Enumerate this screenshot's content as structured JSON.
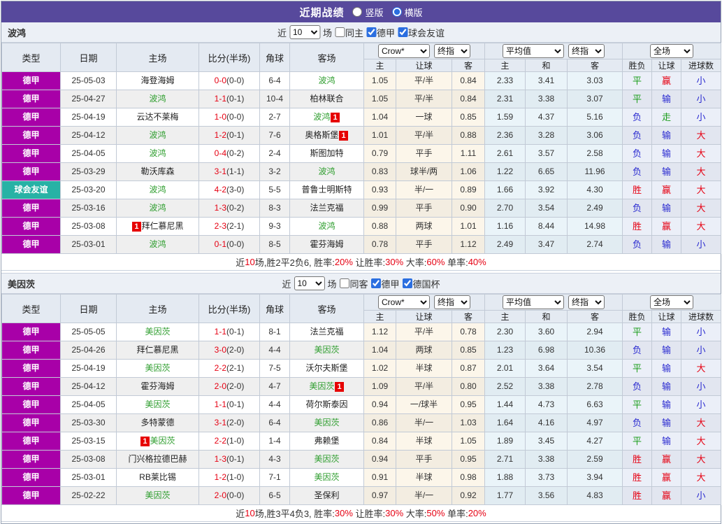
{
  "titlebar": {
    "title": "近期战绩",
    "vertical_label": "竖版",
    "horizontal_label": "横版",
    "selected_layout": "横版"
  },
  "colors": {
    "topbar": "#57499c",
    "league_dejia": "#a800a8",
    "league_friendly": "#27b2a5",
    "focus_team_green": "#2f9e2f",
    "score_red": "#e60012",
    "win_red": "#e60012",
    "draw_green": "#1e9e1e",
    "lose_blue": "#2a2ad0"
  },
  "league_colors": {
    "德甲": "#a800a8",
    "球会友谊": "#27b2a5"
  },
  "columns": {
    "main": [
      "类型",
      "日期",
      "主场",
      "比分(半场)",
      "角球",
      "客场"
    ],
    "sub": [
      "主",
      "让球",
      "客",
      "主",
      "和",
      "客",
      "胜负",
      "让球",
      "进球数"
    ]
  },
  "selects": {
    "bookmaker": "Crow*",
    "final_index": "终指",
    "average": "平均值",
    "final_index2": "终指",
    "scope": "全场"
  },
  "tables": [
    {
      "team": "波鸿",
      "controls": {
        "near_label": "近",
        "count": "10",
        "games_label": "场",
        "same_label": "同主",
        "same_checked": false,
        "league1_label": "德甲",
        "league1_checked": true,
        "league2_label": "球会友谊",
        "league2_checked": true
      },
      "rows": [
        {
          "type": "德甲",
          "date": "25-05-03",
          "home": "海登海姆",
          "home_focus": false,
          "home_rc": 0,
          "score": "0-0",
          "half": "(0-0)",
          "corner": "6-4",
          "away": "波鸿",
          "away_focus": true,
          "away_rc": 0,
          "odds": [
            "1.05",
            "平/半",
            "0.84"
          ],
          "avg": [
            "2.33",
            "3.41",
            "3.03"
          ],
          "result": [
            "平",
            "赢",
            "小"
          ]
        },
        {
          "type": "德甲",
          "date": "25-04-27",
          "home": "波鸿",
          "home_focus": true,
          "home_rc": 0,
          "score": "1-1",
          "half": "(0-1)",
          "corner": "10-4",
          "away": "柏林联合",
          "away_focus": false,
          "away_rc": 0,
          "odds": [
            "1.05",
            "平/半",
            "0.84"
          ],
          "avg": [
            "2.31",
            "3.38",
            "3.07"
          ],
          "result": [
            "平",
            "输",
            "小"
          ]
        },
        {
          "type": "德甲",
          "date": "25-04-19",
          "home": "云达不莱梅",
          "home_focus": false,
          "home_rc": 0,
          "score": "1-0",
          "half": "(0-0)",
          "corner": "2-7",
          "away": "波鸿",
          "away_focus": true,
          "away_rc": 1,
          "odds": [
            "1.04",
            "一球",
            "0.85"
          ],
          "avg": [
            "1.59",
            "4.37",
            "5.16"
          ],
          "result": [
            "负",
            "走",
            "小"
          ]
        },
        {
          "type": "德甲",
          "date": "25-04-12",
          "home": "波鸿",
          "home_focus": true,
          "home_rc": 0,
          "score": "1-2",
          "half": "(0-1)",
          "corner": "7-6",
          "away": "奥格斯堡",
          "away_focus": false,
          "away_rc": 1,
          "odds": [
            "1.01",
            "平/半",
            "0.88"
          ],
          "avg": [
            "2.36",
            "3.28",
            "3.06"
          ],
          "result": [
            "负",
            "输",
            "大"
          ]
        },
        {
          "type": "德甲",
          "date": "25-04-05",
          "home": "波鸿",
          "home_focus": true,
          "home_rc": 0,
          "score": "0-4",
          "half": "(0-2)",
          "corner": "2-4",
          "away": "斯图加特",
          "away_focus": false,
          "away_rc": 0,
          "odds": [
            "0.79",
            "平手",
            "1.11"
          ],
          "avg": [
            "2.61",
            "3.57",
            "2.58"
          ],
          "result": [
            "负",
            "输",
            "大"
          ]
        },
        {
          "type": "德甲",
          "date": "25-03-29",
          "home": "勒沃库森",
          "home_focus": false,
          "home_rc": 0,
          "score": "3-1",
          "half": "(1-1)",
          "corner": "3-2",
          "away": "波鸿",
          "away_focus": true,
          "away_rc": 0,
          "odds": [
            "0.83",
            "球半/两",
            "1.06"
          ],
          "avg": [
            "1.22",
            "6.65",
            "11.96"
          ],
          "result": [
            "负",
            "输",
            "大"
          ]
        },
        {
          "type": "球会友谊",
          "date": "25-03-20",
          "home": "波鸿",
          "home_focus": true,
          "home_rc": 0,
          "score": "4-2",
          "half": "(3-0)",
          "corner": "5-5",
          "away": "普鲁士明斯特",
          "away_focus": false,
          "away_rc": 0,
          "odds": [
            "0.93",
            "半/一",
            "0.89"
          ],
          "avg": [
            "1.66",
            "3.92",
            "4.30"
          ],
          "result": [
            "胜",
            "赢",
            "大"
          ]
        },
        {
          "type": "德甲",
          "date": "25-03-16",
          "home": "波鸿",
          "home_focus": true,
          "home_rc": 0,
          "score": "1-3",
          "half": "(0-2)",
          "corner": "8-3",
          "away": "法兰克福",
          "away_focus": false,
          "away_rc": 0,
          "odds": [
            "0.99",
            "平手",
            "0.90"
          ],
          "avg": [
            "2.70",
            "3.54",
            "2.49"
          ],
          "result": [
            "负",
            "输",
            "大"
          ]
        },
        {
          "type": "德甲",
          "date": "25-03-08",
          "home": "拜仁慕尼黑",
          "home_focus": false,
          "home_rc": 1,
          "score": "2-3",
          "half": "(2-1)",
          "corner": "9-3",
          "away": "波鸿",
          "away_focus": true,
          "away_rc": 0,
          "odds": [
            "0.88",
            "两球",
            "1.01"
          ],
          "avg": [
            "1.16",
            "8.44",
            "14.98"
          ],
          "result": [
            "胜",
            "赢",
            "大"
          ]
        },
        {
          "type": "德甲",
          "date": "25-03-01",
          "home": "波鸿",
          "home_focus": true,
          "home_rc": 0,
          "score": "0-1",
          "half": "(0-0)",
          "corner": "8-5",
          "away": "霍芬海姆",
          "away_focus": false,
          "away_rc": 0,
          "odds": [
            "0.78",
            "平手",
            "1.12"
          ],
          "avg": [
            "2.49",
            "3.47",
            "2.74"
          ],
          "result": [
            "负",
            "输",
            "小"
          ]
        }
      ],
      "summary": [
        {
          "t": "近",
          "red": false
        },
        {
          "t": "10",
          "red": true
        },
        {
          "t": "场,胜2平2负6, 胜率:",
          "red": false
        },
        {
          "t": "20%",
          "red": true
        },
        {
          "t": " 让胜率:",
          "red": false
        },
        {
          "t": "30%",
          "red": true
        },
        {
          "t": " 大率:",
          "red": false
        },
        {
          "t": "60%",
          "red": true
        },
        {
          "t": " 单率:",
          "red": false
        },
        {
          "t": "40%",
          "red": true
        }
      ]
    },
    {
      "team": "美因茨",
      "controls": {
        "near_label": "近",
        "count": "10",
        "games_label": "场",
        "same_label": "同客",
        "same_checked": false,
        "league1_label": "德甲",
        "league1_checked": true,
        "league2_label": "德国杯",
        "league2_checked": true
      },
      "rows": [
        {
          "type": "德甲",
          "date": "25-05-05",
          "home": "美因茨",
          "home_focus": true,
          "home_rc": 0,
          "score": "1-1",
          "half": "(0-1)",
          "corner": "8-1",
          "away": "法兰克福",
          "away_focus": false,
          "away_rc": 0,
          "odds": [
            "1.12",
            "平/半",
            "0.78"
          ],
          "avg": [
            "2.30",
            "3.60",
            "2.94"
          ],
          "result": [
            "平",
            "输",
            "小"
          ]
        },
        {
          "type": "德甲",
          "date": "25-04-26",
          "home": "拜仁慕尼黑",
          "home_focus": false,
          "home_rc": 0,
          "score": "3-0",
          "half": "(2-0)",
          "corner": "4-4",
          "away": "美因茨",
          "away_focus": true,
          "away_rc": 0,
          "odds": [
            "1.04",
            "两球",
            "0.85"
          ],
          "avg": [
            "1.23",
            "6.98",
            "10.36"
          ],
          "result": [
            "负",
            "输",
            "小"
          ]
        },
        {
          "type": "德甲",
          "date": "25-04-19",
          "home": "美因茨",
          "home_focus": true,
          "home_rc": 0,
          "score": "2-2",
          "half": "(2-1)",
          "corner": "7-5",
          "away": "沃尔夫斯堡",
          "away_focus": false,
          "away_rc": 0,
          "odds": [
            "1.02",
            "半球",
            "0.87"
          ],
          "avg": [
            "2.01",
            "3.64",
            "3.54"
          ],
          "result": [
            "平",
            "输",
            "大"
          ]
        },
        {
          "type": "德甲",
          "date": "25-04-12",
          "home": "霍芬海姆",
          "home_focus": false,
          "home_rc": 0,
          "score": "2-0",
          "half": "(2-0)",
          "corner": "4-7",
          "away": "美因茨",
          "away_focus": true,
          "away_rc": 1,
          "odds": [
            "1.09",
            "平/半",
            "0.80"
          ],
          "avg": [
            "2.52",
            "3.38",
            "2.78"
          ],
          "result": [
            "负",
            "输",
            "小"
          ]
        },
        {
          "type": "德甲",
          "date": "25-04-05",
          "home": "美因茨",
          "home_focus": true,
          "home_rc": 0,
          "score": "1-1",
          "half": "(0-1)",
          "corner": "4-4",
          "away": "荷尔斯泰因",
          "away_focus": false,
          "away_rc": 0,
          "odds": [
            "0.94",
            "一/球半",
            "0.95"
          ],
          "avg": [
            "1.44",
            "4.73",
            "6.63"
          ],
          "result": [
            "平",
            "输",
            "小"
          ]
        },
        {
          "type": "德甲",
          "date": "25-03-30",
          "home": "多特蒙德",
          "home_focus": false,
          "home_rc": 0,
          "score": "3-1",
          "half": "(2-0)",
          "corner": "6-4",
          "away": "美因茨",
          "away_focus": true,
          "away_rc": 0,
          "odds": [
            "0.86",
            "半/一",
            "1.03"
          ],
          "avg": [
            "1.64",
            "4.16",
            "4.97"
          ],
          "result": [
            "负",
            "输",
            "大"
          ]
        },
        {
          "type": "德甲",
          "date": "25-03-15",
          "home": "美因茨",
          "home_focus": true,
          "home_rc": 1,
          "score": "2-2",
          "half": "(1-0)",
          "corner": "1-4",
          "away": "弗赖堡",
          "away_focus": false,
          "away_rc": 0,
          "odds": [
            "0.84",
            "半球",
            "1.05"
          ],
          "avg": [
            "1.89",
            "3.45",
            "4.27"
          ],
          "result": [
            "平",
            "输",
            "大"
          ]
        },
        {
          "type": "德甲",
          "date": "25-03-08",
          "home": "门兴格拉德巴赫",
          "home_focus": false,
          "home_rc": 0,
          "score": "1-3",
          "half": "(0-1)",
          "corner": "4-3",
          "away": "美因茨",
          "away_focus": true,
          "away_rc": 0,
          "odds": [
            "0.94",
            "平手",
            "0.95"
          ],
          "avg": [
            "2.71",
            "3.38",
            "2.59"
          ],
          "result": [
            "胜",
            "赢",
            "大"
          ]
        },
        {
          "type": "德甲",
          "date": "25-03-01",
          "home": "RB莱比锡",
          "home_focus": false,
          "home_rc": 0,
          "score": "1-2",
          "half": "(1-0)",
          "corner": "7-1",
          "away": "美因茨",
          "away_focus": true,
          "away_rc": 0,
          "odds": [
            "0.91",
            "半球",
            "0.98"
          ],
          "avg": [
            "1.88",
            "3.73",
            "3.94"
          ],
          "result": [
            "胜",
            "赢",
            "大"
          ]
        },
        {
          "type": "德甲",
          "date": "25-02-22",
          "home": "美因茨",
          "home_focus": true,
          "home_rc": 0,
          "score": "2-0",
          "half": "(0-0)",
          "corner": "6-5",
          "away": "圣保利",
          "away_focus": false,
          "away_rc": 0,
          "odds": [
            "0.97",
            "半/一",
            "0.92"
          ],
          "avg": [
            "1.77",
            "3.56",
            "4.83"
          ],
          "result": [
            "胜",
            "赢",
            "小"
          ]
        }
      ],
      "summary": [
        {
          "t": "近",
          "red": false
        },
        {
          "t": "10",
          "red": true
        },
        {
          "t": "场,胜3平4负3, 胜率:",
          "red": false
        },
        {
          "t": "30%",
          "red": true
        },
        {
          "t": " 让胜率:",
          "red": false
        },
        {
          "t": "30%",
          "red": true
        },
        {
          "t": " 大率:",
          "red": false
        },
        {
          "t": "50%",
          "red": true
        },
        {
          "t": " 单率:",
          "red": false
        },
        {
          "t": "20%",
          "red": true
        }
      ]
    }
  ]
}
